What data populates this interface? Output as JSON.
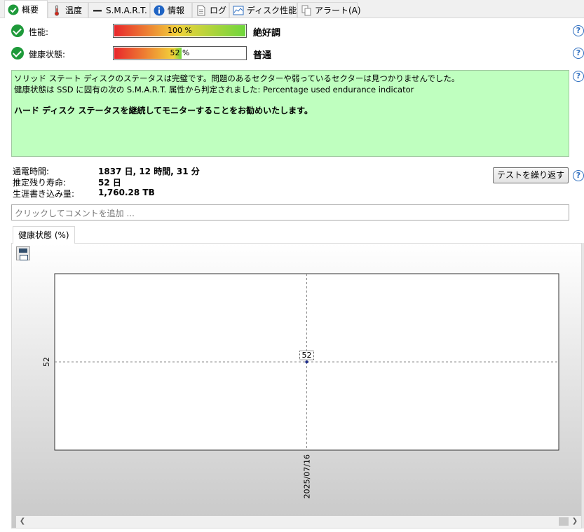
{
  "tabs": [
    {
      "label": "概要",
      "icon": "check-circle-icon"
    },
    {
      "label": "温度",
      "icon": "thermometer-icon"
    },
    {
      "label": "S.M.A.R.T.",
      "icon": "smart-dash-icon"
    },
    {
      "label": "情報",
      "icon": "info-icon"
    },
    {
      "label": "ログ",
      "icon": "document-icon"
    },
    {
      "label": "ディスク性能",
      "icon": "chart-icon"
    },
    {
      "label": "アラート(A)",
      "icon": "alert-copy-icon"
    }
  ],
  "performance": {
    "label": "性能:",
    "percent_text": "100 %",
    "value": 100,
    "verdict": "絶好調"
  },
  "health": {
    "label": "健康状態:",
    "percent_text": "52 %",
    "value": 52,
    "verdict": "普通"
  },
  "status": {
    "line1": "ソリッド ステート ディスクのステータスは完璧です。問題のあるセクターや弱っているセクターは見つかりませんでした。",
    "line2": "健康状態は SSD に固有の次の S.M.A.R.T. 属性から判定されました:  Percentage used endurance indicator",
    "advice": "ハード ディスク ステータスを継続してモニターすることをお勧めいたします。"
  },
  "info": {
    "power_on_label": "通電時間:",
    "power_on_value": "1837 日, 12 時間, 31 分",
    "remaining_label": "推定残り寿命:",
    "remaining_value": "52 日",
    "written_label": "生涯書き込み量:",
    "written_value": "1,760.28 TB"
  },
  "retest_button": "テストを繰り返す",
  "help_symbol": "?",
  "comment_placeholder": "クリックしてコメントを追加 ...",
  "chart_tab": "健康状態 (%)",
  "colors": {
    "accent_green": "#1e9a3a",
    "status_bg": "#bfffbf",
    "help_blue": "#2f6fc0"
  },
  "chart_data": {
    "type": "line",
    "title": "",
    "x": [
      "2025/07/16"
    ],
    "series": [
      {
        "values": [
          52
        ]
      }
    ],
    "ytick_labels": [
      "52"
    ],
    "xtick_labels": [
      "2025/07/16"
    ],
    "data_labels": [
      "52"
    ],
    "grid": true
  }
}
